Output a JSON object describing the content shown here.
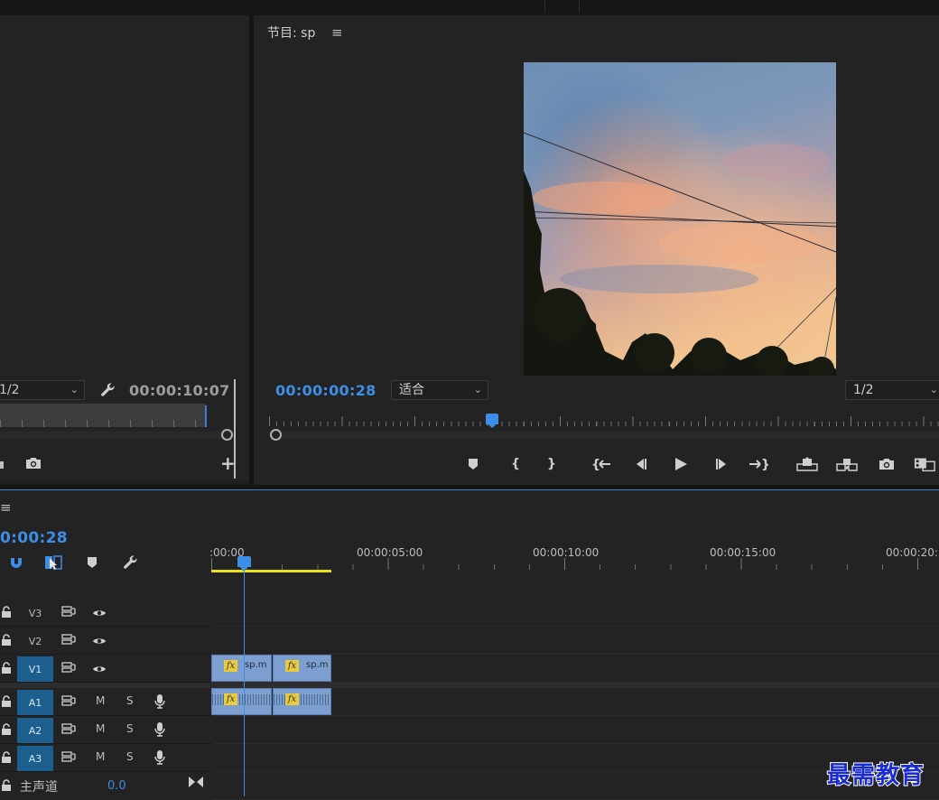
{
  "source_monitor": {
    "resolution": "1/2",
    "timecode": "00:00:10:07"
  },
  "program_monitor": {
    "title": "节目: sp",
    "timecode": "00:00:00:28",
    "fit": "适合",
    "resolution": "1/2",
    "controls": [
      "marker-icon",
      "mark-in-icon",
      "mark-out-icon",
      "go-to-in-icon",
      "step-back-icon",
      "play-icon",
      "step-forward-icon",
      "go-to-out-icon",
      "lift-icon",
      "extract-icon",
      "camera-icon",
      "compare-icon"
    ]
  },
  "timeline": {
    "timecode": "0:00:28",
    "ruler_labels": [
      ":00:00",
      "00:00:05:00",
      "00:00:10:00",
      "00:00:15:00",
      "00:00:20:"
    ],
    "tracks": [
      {
        "label": "V3",
        "kind": "video",
        "active": false
      },
      {
        "label": "V2",
        "kind": "video",
        "active": false
      },
      {
        "label": "V1",
        "kind": "video",
        "active": true
      },
      {
        "label": "A1",
        "kind": "audio",
        "active": true
      },
      {
        "label": "A2",
        "kind": "audio",
        "active": true
      },
      {
        "label": "A3",
        "kind": "audio",
        "active": true
      }
    ],
    "mute_label": "M",
    "solo_label": "S",
    "video_clips": [
      {
        "name": "sp.m",
        "fx": "fx"
      },
      {
        "name": "sp.m",
        "fx": "fx"
      }
    ],
    "audio_clips": [
      {
        "fx": "fx"
      },
      {
        "fx": "fx"
      }
    ],
    "master": {
      "label": "主声道",
      "value": "0.0"
    }
  },
  "watermark": "最需教育",
  "colors": {
    "accent": "#3d8ee6",
    "panel": "#232323",
    "clip": "#7d9fd0",
    "work_area": "#e7e21a",
    "track_active": "#1c5e8e"
  }
}
